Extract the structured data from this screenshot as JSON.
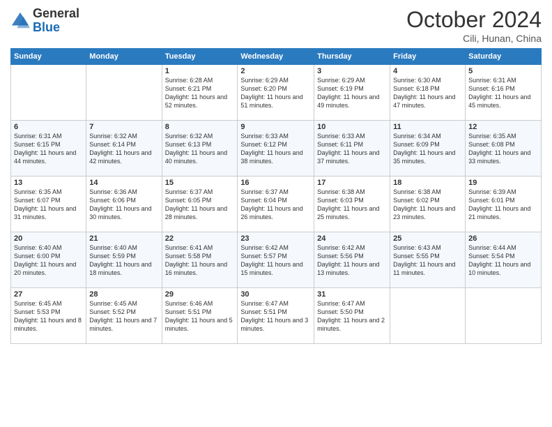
{
  "header": {
    "logo_general": "General",
    "logo_blue": "Blue",
    "month_title": "October 2024",
    "subtitle": "Cili, Hunan, China"
  },
  "days_of_week": [
    "Sunday",
    "Monday",
    "Tuesday",
    "Wednesday",
    "Thursday",
    "Friday",
    "Saturday"
  ],
  "weeks": [
    [
      {
        "day": "",
        "info": ""
      },
      {
        "day": "",
        "info": ""
      },
      {
        "day": "1",
        "info": "Sunrise: 6:28 AM\nSunset: 6:21 PM\nDaylight: 11 hours and 52 minutes."
      },
      {
        "day": "2",
        "info": "Sunrise: 6:29 AM\nSunset: 6:20 PM\nDaylight: 11 hours and 51 minutes."
      },
      {
        "day": "3",
        "info": "Sunrise: 6:29 AM\nSunset: 6:19 PM\nDaylight: 11 hours and 49 minutes."
      },
      {
        "day": "4",
        "info": "Sunrise: 6:30 AM\nSunset: 6:18 PM\nDaylight: 11 hours and 47 minutes."
      },
      {
        "day": "5",
        "info": "Sunrise: 6:31 AM\nSunset: 6:16 PM\nDaylight: 11 hours and 45 minutes."
      }
    ],
    [
      {
        "day": "6",
        "info": "Sunrise: 6:31 AM\nSunset: 6:15 PM\nDaylight: 11 hours and 44 minutes."
      },
      {
        "day": "7",
        "info": "Sunrise: 6:32 AM\nSunset: 6:14 PM\nDaylight: 11 hours and 42 minutes."
      },
      {
        "day": "8",
        "info": "Sunrise: 6:32 AM\nSunset: 6:13 PM\nDaylight: 11 hours and 40 minutes."
      },
      {
        "day": "9",
        "info": "Sunrise: 6:33 AM\nSunset: 6:12 PM\nDaylight: 11 hours and 38 minutes."
      },
      {
        "day": "10",
        "info": "Sunrise: 6:33 AM\nSunset: 6:11 PM\nDaylight: 11 hours and 37 minutes."
      },
      {
        "day": "11",
        "info": "Sunrise: 6:34 AM\nSunset: 6:09 PM\nDaylight: 11 hours and 35 minutes."
      },
      {
        "day": "12",
        "info": "Sunrise: 6:35 AM\nSunset: 6:08 PM\nDaylight: 11 hours and 33 minutes."
      }
    ],
    [
      {
        "day": "13",
        "info": "Sunrise: 6:35 AM\nSunset: 6:07 PM\nDaylight: 11 hours and 31 minutes."
      },
      {
        "day": "14",
        "info": "Sunrise: 6:36 AM\nSunset: 6:06 PM\nDaylight: 11 hours and 30 minutes."
      },
      {
        "day": "15",
        "info": "Sunrise: 6:37 AM\nSunset: 6:05 PM\nDaylight: 11 hours and 28 minutes."
      },
      {
        "day": "16",
        "info": "Sunrise: 6:37 AM\nSunset: 6:04 PM\nDaylight: 11 hours and 26 minutes."
      },
      {
        "day": "17",
        "info": "Sunrise: 6:38 AM\nSunset: 6:03 PM\nDaylight: 11 hours and 25 minutes."
      },
      {
        "day": "18",
        "info": "Sunrise: 6:38 AM\nSunset: 6:02 PM\nDaylight: 11 hours and 23 minutes."
      },
      {
        "day": "19",
        "info": "Sunrise: 6:39 AM\nSunset: 6:01 PM\nDaylight: 11 hours and 21 minutes."
      }
    ],
    [
      {
        "day": "20",
        "info": "Sunrise: 6:40 AM\nSunset: 6:00 PM\nDaylight: 11 hours and 20 minutes."
      },
      {
        "day": "21",
        "info": "Sunrise: 6:40 AM\nSunset: 5:59 PM\nDaylight: 11 hours and 18 minutes."
      },
      {
        "day": "22",
        "info": "Sunrise: 6:41 AM\nSunset: 5:58 PM\nDaylight: 11 hours and 16 minutes."
      },
      {
        "day": "23",
        "info": "Sunrise: 6:42 AM\nSunset: 5:57 PM\nDaylight: 11 hours and 15 minutes."
      },
      {
        "day": "24",
        "info": "Sunrise: 6:42 AM\nSunset: 5:56 PM\nDaylight: 11 hours and 13 minutes."
      },
      {
        "day": "25",
        "info": "Sunrise: 6:43 AM\nSunset: 5:55 PM\nDaylight: 11 hours and 11 minutes."
      },
      {
        "day": "26",
        "info": "Sunrise: 6:44 AM\nSunset: 5:54 PM\nDaylight: 11 hours and 10 minutes."
      }
    ],
    [
      {
        "day": "27",
        "info": "Sunrise: 6:45 AM\nSunset: 5:53 PM\nDaylight: 11 hours and 8 minutes."
      },
      {
        "day": "28",
        "info": "Sunrise: 6:45 AM\nSunset: 5:52 PM\nDaylight: 11 hours and 7 minutes."
      },
      {
        "day": "29",
        "info": "Sunrise: 6:46 AM\nSunset: 5:51 PM\nDaylight: 11 hours and 5 minutes."
      },
      {
        "day": "30",
        "info": "Sunrise: 6:47 AM\nSunset: 5:51 PM\nDaylight: 11 hours and 3 minutes."
      },
      {
        "day": "31",
        "info": "Sunrise: 6:47 AM\nSunset: 5:50 PM\nDaylight: 11 hours and 2 minutes."
      },
      {
        "day": "",
        "info": ""
      },
      {
        "day": "",
        "info": ""
      }
    ]
  ]
}
